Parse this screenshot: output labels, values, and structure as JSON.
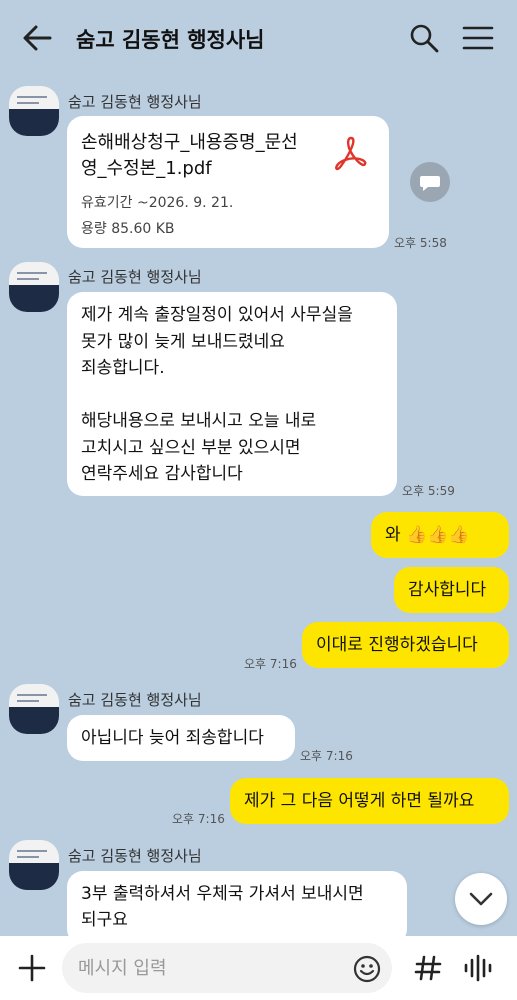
{
  "header": {
    "title": "숨고 김동현 행정사님"
  },
  "sender_name": "숨고 김동현 행정사님",
  "file_message": {
    "file_name": "손해배상청구_내용증명_문선영_수정본_1.pdf",
    "expiry": "유효기간 ~2026. 9. 21.",
    "size": "용량  85.60 KB",
    "time": "오후 5:58"
  },
  "msg_delay": {
    "text": "제가 계속 출장일정이 있어서 사무실을\n못가 많이 늦게 보내드렸네요\n죄송합니다.\n\n해당내용으로 보내시고 오늘 내로\n고치시고 싶으신 부분 있으시면\n연락주세요 감사합니다",
    "time": "오후 5:59"
  },
  "my_msgs": [
    {
      "text": "와 👍👍👍"
    },
    {
      "text": "감사합니다"
    },
    {
      "text": "이대로 진행하겠습니다",
      "time": "오후 7:16"
    }
  ],
  "msg_sorry": {
    "text": "아닙니다 늦어 죄송합니다",
    "time": "오후 7:16"
  },
  "my_msg_next": {
    "text": "제가 그 다음 어떻게 하면 될까요",
    "time": "오후 7:16"
  },
  "msg_print": {
    "text": "3부 출력하셔서 우체국 가셔서 보내시면\n되구요"
  },
  "input": {
    "placeholder": "메시지 입력"
  },
  "colors": {
    "background": "#bacee0",
    "my_bubble": "#fee500",
    "their_bubble": "#ffffff",
    "pdf_red": "#e0352b"
  }
}
